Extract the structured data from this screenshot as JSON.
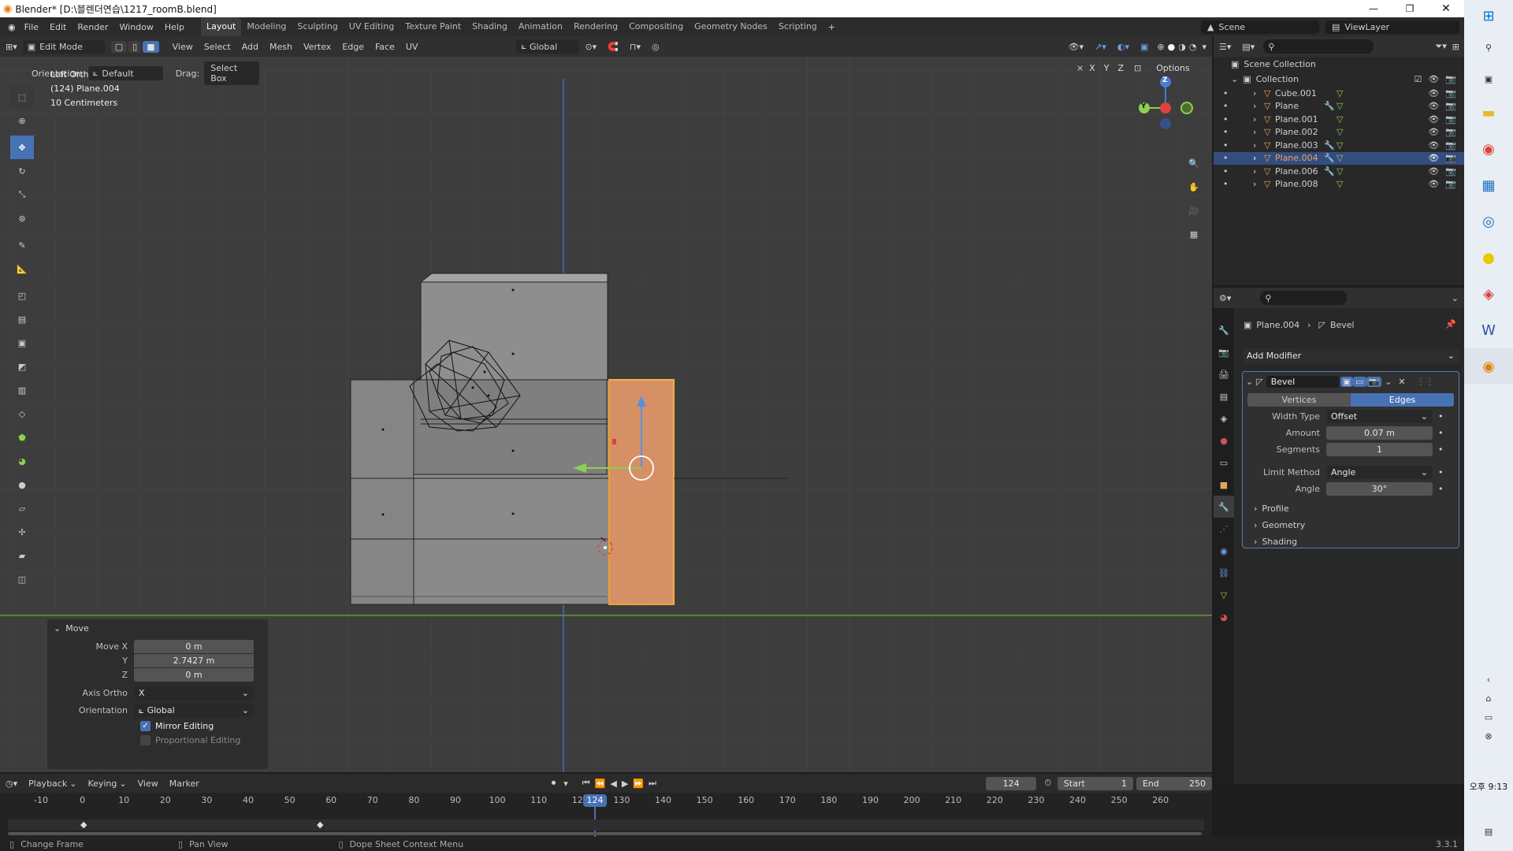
{
  "window": {
    "title": "Blender* [D:\\블렌더연습\\1217_roomB.blend]"
  },
  "menu": {
    "items": [
      "File",
      "Edit",
      "Render",
      "Window",
      "Help"
    ],
    "workspaces": [
      "Layout",
      "Modeling",
      "Sculpting",
      "UV Editing",
      "Texture Paint",
      "Shading",
      "Animation",
      "Rendering",
      "Compositing",
      "Geometry Nodes",
      "Scripting"
    ],
    "active_workspace": "Layout",
    "scene": "Scene",
    "view_layer": "ViewLayer"
  },
  "header": {
    "mode": "Edit Mode",
    "menus": [
      "View",
      "Select",
      "Add",
      "Mesh",
      "Vertex",
      "Edge",
      "Face",
      "UV"
    ],
    "transform_orientation": "Global",
    "orientation_label": "Orientation:",
    "orientation_value": "Default",
    "drag_label": "Drag:",
    "drag_value": "Select Box",
    "options": "Options",
    "axes": [
      "X",
      "Y",
      "Z"
    ]
  },
  "viewport": {
    "info_view": "Left Orthographic (Local)",
    "info_object": "(124) Plane.004",
    "info_scale": "10 Centimeters",
    "gizmo_axes": [
      "Z",
      "Y"
    ]
  },
  "move_panel": {
    "title": "Move",
    "move_x_label": "Move X",
    "move_x": "0 m",
    "y_label": "Y",
    "y": "2.7427 m",
    "z_label": "Z",
    "z": "0 m",
    "axis_ortho_label": "Axis Ortho",
    "axis_ortho": "X",
    "orientation_label": "Orientation",
    "orientation": "Global",
    "mirror_editing": "Mirror Editing",
    "mirror_checked": true,
    "proportional_editing": "Proportional Editing",
    "proportional_checked": false
  },
  "outliner": {
    "scene_collection": "Scene Collection",
    "collection": "Collection",
    "objects": [
      {
        "name": "Cube.001",
        "wrench": false
      },
      {
        "name": "Plane",
        "wrench": true
      },
      {
        "name": "Plane.001",
        "wrench": false
      },
      {
        "name": "Plane.002",
        "wrench": false
      },
      {
        "name": "Plane.003",
        "wrench": true
      },
      {
        "name": "Plane.004",
        "wrench": true,
        "selected": true
      },
      {
        "name": "Plane.006",
        "wrench": true
      },
      {
        "name": "Plane.008",
        "wrench": false
      }
    ]
  },
  "properties": {
    "breadcrumb_object": "Plane.004",
    "breadcrumb_modifier": "Bevel",
    "add_modifier": "Add Modifier",
    "modifier_name": "Bevel",
    "tab_vertices": "Vertices",
    "tab_edges": "Edges",
    "width_type_label": "Width Type",
    "width_type": "Offset",
    "amount_label": "Amount",
    "amount": "0.07 m",
    "segments_label": "Segments",
    "segments": "1",
    "limit_method_label": "Limit Method",
    "limit_method": "Angle",
    "angle_label": "Angle",
    "angle": "30°",
    "subpanels": [
      "Profile",
      "Geometry",
      "Shading"
    ]
  },
  "timeline": {
    "menus": [
      "Playback",
      "Keying",
      "View",
      "Marker"
    ],
    "current_frame": "124",
    "start_label": "Start",
    "start": "1",
    "end_label": "End",
    "end": "250",
    "ruler": [
      "-10",
      "0",
      "10",
      "20",
      "30",
      "40",
      "50",
      "60",
      "70",
      "80",
      "90",
      "100",
      "110",
      "120",
      "130",
      "140",
      "150",
      "160",
      "170",
      "180",
      "190",
      "200",
      "210",
      "220",
      "230",
      "240",
      "250",
      "260"
    ]
  },
  "status": {
    "change_frame": "Change Frame",
    "pan_view": "Pan View",
    "context_menu": "Dope Sheet Context Menu",
    "version": "3.3.1"
  },
  "taskbar": {
    "time": "오후 9:13"
  },
  "colors": {
    "accent": "#4772b3",
    "selected_orange": "#e8a35f",
    "highlight_row": "#334d80"
  }
}
